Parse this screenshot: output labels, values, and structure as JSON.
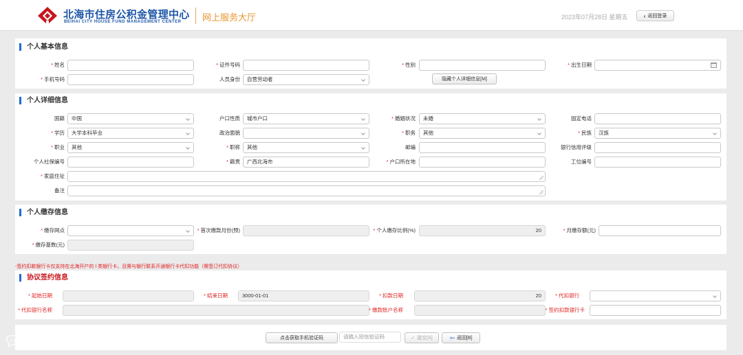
{
  "header": {
    "org_name": "北海市住房公积金管理中心",
    "org_name_en": "BEIHAI CITY HOUSE FUND MANAGEMENT CENTER",
    "hall_title": "网上服务大厅",
    "date": "2023年07月28日 星期五",
    "back_login": "返回登录",
    "colors": {
      "brand_blue": "#1e56a8",
      "logo_red": "#c8161d",
      "accent_orange": "#e8962f"
    }
  },
  "basic": {
    "title": "个人基本信息",
    "name_label": "姓名",
    "id_no_label": "证件号码",
    "gender_label": "性别",
    "birth_label": "出生日期",
    "phone_label": "手机号码",
    "identity_label": "人员身份",
    "identity_value": "自营劳动者",
    "toggle_detail": "隐藏个人详细信息[M]"
  },
  "detail": {
    "title": "个人详细信息",
    "nationality_label": "国籍",
    "nationality_value": "中国",
    "hukou_type_label": "户口性质",
    "hukou_type_value": "城市户口",
    "marital_label": "婚姻状况",
    "marital_value": "未婚",
    "landline_label": "固定电话",
    "education_label": "学历",
    "education_value": "大学本科毕业",
    "political_label": "政治面貌",
    "duty_label": "职务",
    "duty_value": "其他",
    "ethnic_label": "民族",
    "ethnic_value": "汉族",
    "occupation_label": "职业",
    "occupation_value": "其他",
    "title_label": "职称",
    "title_value": "其他",
    "zip_label": "邮编",
    "credit_label": "银行信用评级",
    "social_label": "个人社保编号",
    "native_label": "籍贯",
    "native_value": "广西北海市",
    "hukou_addr_label": "户口所在地",
    "job_no_label": "工位编号",
    "address_label": "家庭住址",
    "remark_label": "备注"
  },
  "deposit": {
    "title": "个人缴存信息",
    "outlet_label": "缴存网点",
    "first_month_label": "首次缴款月份(预)",
    "ratio_label": "个人缴存比例(%)",
    "ratio_value": "20",
    "monthly_label": "月缴存额(元)",
    "base_label": "缴存基数(元)"
  },
  "notice": "-签约扣款银行卡仅支持在北海开户的 I 类银行卡，且需与银行联系开通银行卡代扣功能（需签订代扣协议）",
  "agreement": {
    "title": "协议签约信息",
    "start_label": "起始日期",
    "end_label": "结束日期",
    "end_value": "3000-01-01",
    "deduct_day_label": "扣款日期",
    "deduct_day_value": "20",
    "bank_label": "代扣银行",
    "bank_name_label": "代扣银行名称",
    "account_name_label": "缴款账户名称",
    "card_label": "签约扣款银行卡"
  },
  "actions": {
    "get_code": "点击获取手机验证码",
    "code_placeholder": "请输入短信验证码",
    "submit": "提交[S]",
    "back": "返回[B]"
  },
  "watermark": "大数跨境"
}
